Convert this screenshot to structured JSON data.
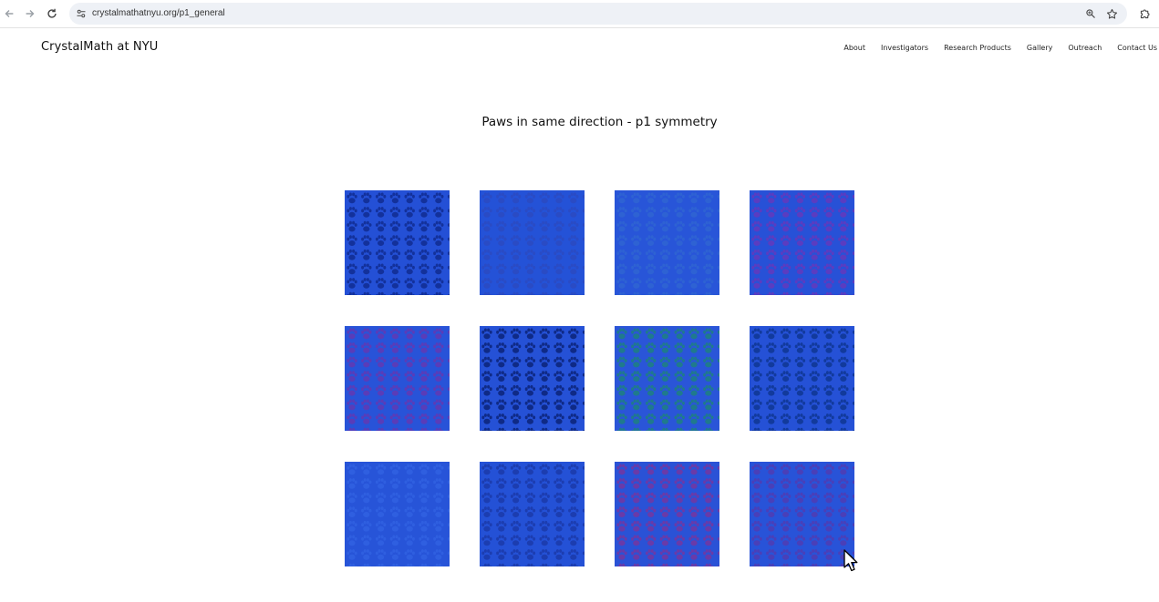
{
  "browser": {
    "url": "crystalmathatnyu.org/p1_general",
    "icons": {
      "back": "back-arrow-icon",
      "forward": "forward-arrow-icon",
      "reload": "reload-icon",
      "site_info": "site-info-icon",
      "zoom": "zoom-icon",
      "bookmark": "star-icon",
      "extensions": "puzzle-icon"
    }
  },
  "site": {
    "title": "CrystalMath at NYU",
    "nav": [
      "About",
      "Investigators",
      "Research Products",
      "Gallery",
      "Outreach",
      "Contact Us"
    ]
  },
  "page": {
    "heading": "Paws in same direction - p1 symmetry"
  },
  "gallery": {
    "tiles": [
      {
        "bg": "#2450d6",
        "paw": "#13319b"
      },
      {
        "bg": "#2452d7",
        "paw": "#2a4bc4"
      },
      {
        "bg": "#2855d8",
        "paw": "#2e62d3"
      },
      {
        "bg": "#2751d7",
        "paw": "#5b3cc0"
      },
      {
        "bg": "#2853d8",
        "paw": "#5a3cb8"
      },
      {
        "bg": "#2551d6",
        "paw": "#0f2a86"
      },
      {
        "bg": "#2a55d8",
        "paw": "#1f7a8c"
      },
      {
        "bg": "#2551d6",
        "paw": "#123a9c"
      },
      {
        "bg": "#2754d8",
        "paw": "#2f5fe0"
      },
      {
        "bg": "#2451d6",
        "paw": "#1c3db0"
      },
      {
        "bg": "#2a52d6",
        "paw": "#6a3aa8"
      },
      {
        "bg": "#2853d8",
        "paw": "#4a3fb8"
      }
    ]
  }
}
